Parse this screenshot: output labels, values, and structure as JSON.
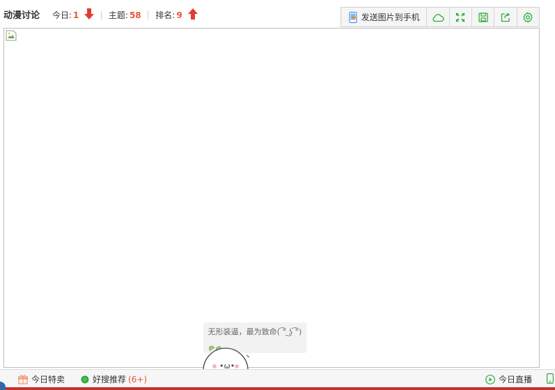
{
  "header": {
    "forum_name": "动漫讨论",
    "stats": [
      {
        "label": "今日:",
        "value": "1",
        "trend": "down"
      },
      {
        "label": "主题:",
        "value": "58"
      },
      {
        "label": "排名:",
        "value": "9",
        "trend": "up"
      }
    ]
  },
  "toolbar": {
    "send_label": "发送图片到手机",
    "buttons": [
      {
        "icon": "cloud-icon"
      },
      {
        "icon": "fullscreen-icon"
      },
      {
        "icon": "save-icon"
      },
      {
        "icon": "share-icon"
      },
      {
        "icon": "settings-icon"
      }
    ]
  },
  "tooltip": {
    "text": "无形装逼，最为致命( ͡° ͜ʖ ͡°)"
  },
  "bottombar": {
    "deals_label": "今日特卖",
    "recommend_label": "好搜推荐",
    "recommend_count": "(6+)",
    "live_label": "今日直播"
  },
  "colors": {
    "accent": "#e8553b",
    "green": "#2eaa3d",
    "frame_border": "#bdbdbd"
  }
}
